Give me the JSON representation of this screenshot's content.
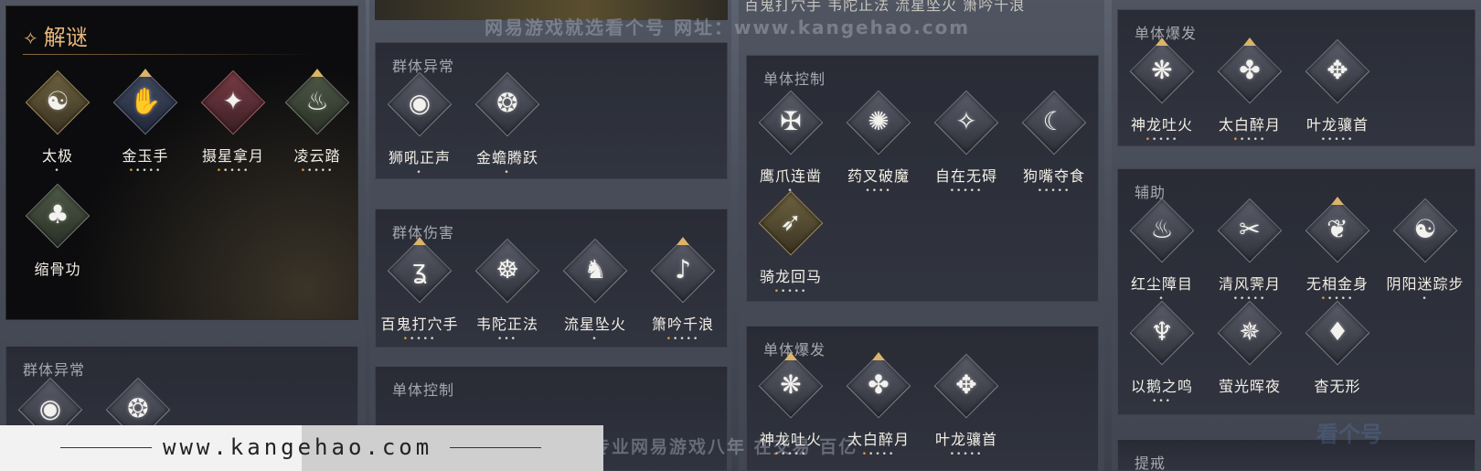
{
  "jiemi": {
    "title": "解谜",
    "skills": [
      {
        "name": "太极",
        "dots": "•",
        "on": 0,
        "glyph": "☯"
      },
      {
        "name": "金玉手",
        "dots": "•••••",
        "on": 1,
        "glyph": "✋"
      },
      {
        "name": "摄星拿月",
        "dots": "•••••",
        "on": 1,
        "glyph": "✦"
      },
      {
        "name": "凌云踏",
        "dots": "•••••",
        "on": 1,
        "glyph": "♨"
      },
      {
        "name": "缩骨功",
        "dots": "",
        "on": 0,
        "glyph": "♣"
      }
    ]
  },
  "col1_lower": {
    "title": "群体异常"
  },
  "col2": {
    "group_anomaly": {
      "title": "群体异常",
      "skills": [
        {
          "name": "狮吼正声",
          "dots": "•",
          "on": 0,
          "glyph": "◉"
        },
        {
          "name": "金蟾腾跃",
          "dots": "•",
          "on": 0,
          "glyph": "❂"
        }
      ]
    },
    "group_damage": {
      "title": "群体伤害",
      "skills": [
        {
          "name": "百鬼打穴手",
          "dots": "•••••",
          "on": 1,
          "glyph": "ʓ"
        },
        {
          "name": "韦陀正法",
          "dots": "•••",
          "on": 0,
          "glyph": "☸"
        },
        {
          "name": "流星坠火",
          "dots": "•",
          "on": 0,
          "glyph": "♞"
        },
        {
          "name": "箫吟千浪",
          "dots": "•••••",
          "on": 1,
          "glyph": "♪"
        }
      ]
    },
    "single_control_partial": {
      "title": "单体控制"
    }
  },
  "col3": {
    "top_cut_text": "百鬼打穴手  韦陀正法  流星坠火  箫吟千浪",
    "single_control": {
      "title": "单体控制",
      "skills": [
        {
          "name": "鹰爪连凿",
          "dots": "•",
          "on": 0,
          "glyph": "✠"
        },
        {
          "name": "药叉破魔",
          "dots": "••••",
          "on": 0,
          "glyph": "✺"
        },
        {
          "name": "自在无碍",
          "dots": "•••••",
          "on": 0,
          "glyph": "✧"
        },
        {
          "name": "狗嘴夺食",
          "dots": "•••••",
          "on": 0,
          "glyph": "☾"
        },
        {
          "name": "骑龙回马",
          "dots": "•••••",
          "on": 1,
          "glyph": "➶"
        }
      ]
    },
    "single_burst": {
      "title": "单体爆发",
      "skills": [
        {
          "name": "神龙吐火",
          "dots": "•••••",
          "on": 1,
          "glyph": "❋"
        },
        {
          "name": "太白醉月",
          "dots": "•••••",
          "on": 1,
          "glyph": "✤"
        },
        {
          "name": "叶龙骧首",
          "dots": "•••••",
          "on": 0,
          "glyph": "✥"
        }
      ]
    }
  },
  "col4": {
    "single_burst": {
      "title": "单体爆发",
      "skills": [
        {
          "name": "神龙吐火",
          "dots": "•••••",
          "on": 1,
          "glyph": "❋"
        },
        {
          "name": "太白醉月",
          "dots": "•••••",
          "on": 1,
          "glyph": "✤"
        },
        {
          "name": "叶龙骧首",
          "dots": "•••••",
          "on": 0,
          "glyph": "✥"
        }
      ]
    },
    "support": {
      "title": "辅助",
      "skills": [
        {
          "name": "红尘障目",
          "dots": "•",
          "on": 0,
          "glyph": "♨"
        },
        {
          "name": "清风霁月",
          "dots": "•••••",
          "on": 0,
          "glyph": "✂"
        },
        {
          "name": "无相金身",
          "dots": "•••••",
          "on": 1,
          "glyph": "❦"
        },
        {
          "name": "阴阳迷踪步",
          "dots": "•",
          "on": 0,
          "glyph": "☯"
        },
        {
          "name": "以鹅之鸣",
          "dots": "•••",
          "on": 0,
          "glyph": "♆"
        },
        {
          "name": "萤光晖夜",
          "dots": "",
          "on": 0,
          "glyph": "✵"
        },
        {
          "name": "杳无形",
          "dots": "",
          "on": 0,
          "glyph": "♦"
        }
      ]
    },
    "bottom_cut_title": "提戒"
  },
  "watermarks": {
    "top": "网易游戏就选看个号  网址：www.kangehao.com",
    "bottom": "看个号专业网易游戏八年  在交易  百亿",
    "footer": "www.kangehao.com",
    "logo": "看个号"
  },
  "colors": {
    "accent_gold": "#e6b67a",
    "dot_active": "#e89a3c",
    "panel_bg": "#2a2c36"
  }
}
